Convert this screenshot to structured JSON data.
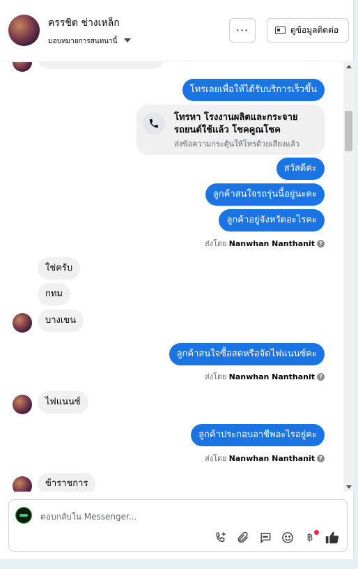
{
  "header": {
    "contact_name": "ครรชิต ช่างเหล็ก",
    "assign_label": "มอบหมายการสนทนานี้",
    "more_label": "···",
    "contact_info_label": "ดูข้อมูลติดต่อ"
  },
  "messages": {
    "m1": "โทรเลยเพื่อให้ได้รับบริการเร็วขึ้น",
    "call_card_title": "โทรหา โรงงานผลิตและกระจายรถยนต์ใช้แล้ว โชคคูณโชค",
    "call_card_subtitle": "ส่งข้อความกระตุ้นให้โทรด้วยเสียงแล้ว",
    "m2": "สวัสดีค่ะ",
    "m3": "ลูกค้าสนใจรถรุ่นนี้อยู่นะคะ",
    "m4": "ลูกค้าอยู่จังหวัดอะไรคะ",
    "in1": "ใช่ครับ",
    "in2": "กทม",
    "in3": "บางเขน",
    "m5": "ลูกค้าสนใจซื้อสดหรือจัดไฟแนนซ์คะ",
    "in4": "ไฟแนนซ์",
    "m6": "ลูกค้าประกอบอาชีพอะไรอยู่คะ",
    "in5": "ข้าราชการ"
  },
  "sent_by": {
    "prefix": "ส่งโดย",
    "name": "Nanwhan Nanthanit"
  },
  "composer": {
    "placeholder": "ตอบกลับใน Messenger...",
    "baht_symbol": "฿"
  },
  "colors": {
    "outgoing_bubble": "#1b74e4",
    "incoming_bubble": "#f0f0f0",
    "notification_dot": "#f02849"
  },
  "icons": [
    "phone-icon",
    "id-card-icon",
    "info-icon",
    "add-call-icon",
    "paperclip-icon",
    "saved-reply-icon",
    "emoji-icon",
    "baht-icon",
    "thumbs-up-icon"
  ]
}
